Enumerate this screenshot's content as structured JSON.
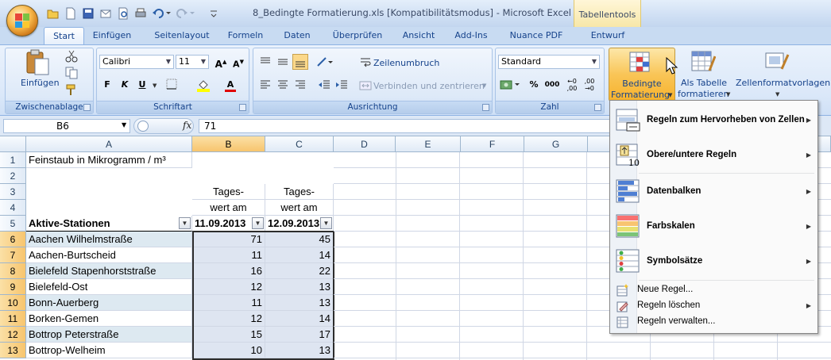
{
  "window": {
    "title": "8_Bedingte Formatierung.xls  [Kompatibilitätsmodus] - Microsoft Excel",
    "contextual_tab_group": "Tabellentools"
  },
  "tabs": [
    "Start",
    "Einfügen",
    "Seitenlayout",
    "Formeln",
    "Daten",
    "Überprüfen",
    "Ansicht",
    "Add-Ins",
    "Nuance PDF",
    "Entwurf"
  ],
  "ribbon": {
    "clipboard": {
      "label": "Zwischenablage",
      "paste": "Einfügen"
    },
    "font": {
      "label": "Schriftart",
      "name": "Calibri",
      "size": "11",
      "bold": "F",
      "italic": "K",
      "underline": "U"
    },
    "alignment": {
      "label": "Ausrichtung",
      "wrap": "Zeilenumbruch",
      "merge": "Verbinden und zentrieren"
    },
    "number": {
      "label": "Zahl",
      "format": "Standard",
      "percent": "%",
      "thousands": "000"
    },
    "styles": {
      "conditional_line1": "Bedingte",
      "conditional_line2": "Formatierung",
      "as_table_line1": "Als Tabelle",
      "as_table_line2": "formatieren",
      "cell_styles": "Zellenformatvorlagen"
    }
  },
  "formula_bar": {
    "name_box": "B6",
    "fx": "fx",
    "value": "71"
  },
  "columns": [
    "A",
    "B",
    "C",
    "D",
    "E",
    "F",
    "G"
  ],
  "rows": [
    {
      "n": "1",
      "a": "Feinstaub in Mikrogramm / m³",
      "b": "",
      "c": ""
    },
    {
      "n": "2",
      "a": "",
      "b": "",
      "c": ""
    },
    {
      "n": "3",
      "a": "",
      "b": "Tages-",
      "c": "Tages-"
    },
    {
      "n": "4",
      "a": "",
      "b": "wert am",
      "c": "wert am"
    },
    {
      "n": "5",
      "a": "Aktive-Stationen",
      "b": "11.09.2013",
      "c": "12.09.2013"
    },
    {
      "n": "6",
      "a": "Aachen Wilhelmstraße",
      "b": "71",
      "c": "45"
    },
    {
      "n": "7",
      "a": "Aachen-Burtscheid",
      "b": "11",
      "c": "14"
    },
    {
      "n": "8",
      "a": "Bielefeld Stapenhorststraße",
      "b": "16",
      "c": "22"
    },
    {
      "n": "9",
      "a": "Bielefeld-Ost",
      "b": "12",
      "c": "13"
    },
    {
      "n": "10",
      "a": "Bonn-Auerberg",
      "b": "11",
      "c": "13"
    },
    {
      "n": "11",
      "a": "Borken-Gemen",
      "b": "12",
      "c": "14"
    },
    {
      "n": "12",
      "a": "Bottrop Peterstraße",
      "b": "15",
      "c": "17"
    },
    {
      "n": "13",
      "a": "Bottrop-Welheim",
      "b": "10",
      "c": "13"
    }
  ],
  "menu": {
    "items": [
      {
        "label": "Regeln zum Hervorheben von Zellen",
        "icon": "highlight-rules-icon"
      },
      {
        "label": "Obere/untere Regeln",
        "icon": "top-bottom-rules-icon"
      },
      {
        "label": "Datenbalken",
        "icon": "data-bars-icon"
      },
      {
        "label": "Farbskalen",
        "icon": "color-scales-icon"
      },
      {
        "label": "Symbolsätze",
        "icon": "icon-sets-icon"
      }
    ],
    "small_items": [
      {
        "label": "Neue Regel...",
        "icon": "new-rule-icon"
      },
      {
        "label": "Regeln löschen",
        "icon": "clear-rules-icon"
      },
      {
        "label": "Regeln verwalten...",
        "icon": "manage-rules-icon"
      }
    ]
  }
}
